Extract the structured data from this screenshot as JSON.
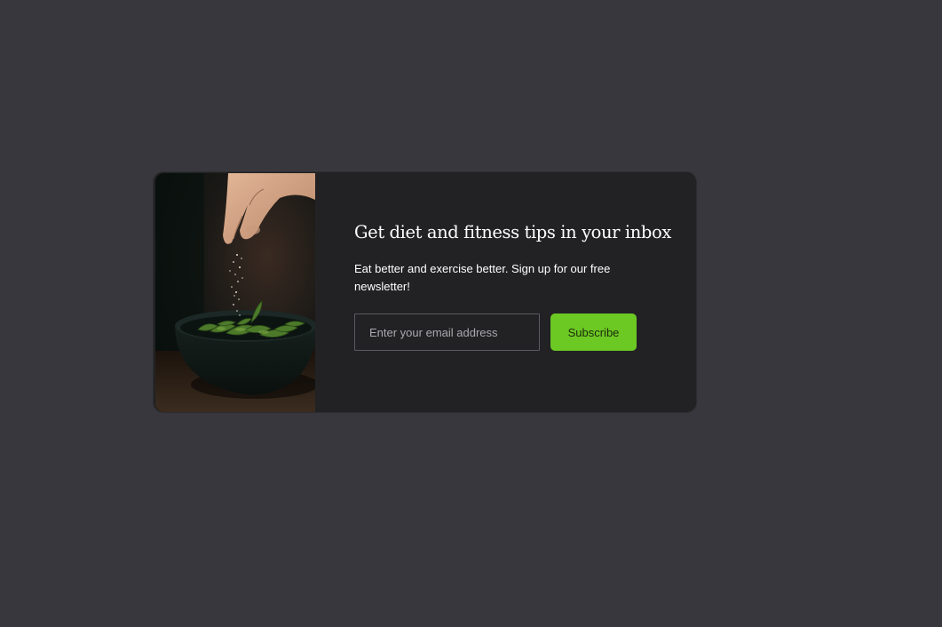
{
  "newsletter": {
    "title": "Get diet and fitness tips in your inbox",
    "description": "Eat better and exercise better. Sign up for our free newsletter!",
    "email_placeholder": "Enter your email address",
    "email_value": "",
    "subscribe_label": "Subscribe"
  },
  "colors": {
    "page_background": "#38373d",
    "card_background": "#222224",
    "accent": "#6cc823",
    "text": "#ffffff"
  },
  "image": {
    "subject": "hand-sprinkling-salt-on-edamame-bowl"
  }
}
